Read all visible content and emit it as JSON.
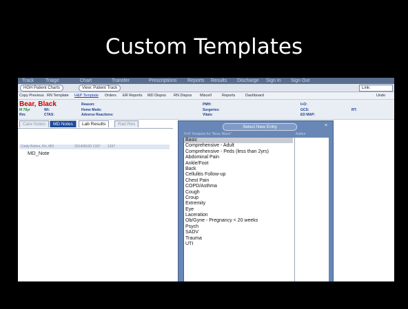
{
  "slide_title": "Custom Templates",
  "nav_tabs": [
    "Track",
    "Triage",
    "Chart",
    "Transfer",
    "Prescriptions",
    "Reports",
    "Results",
    "Discharge",
    "Sign In",
    "Sign Out"
  ],
  "patient_chart_button": "HGH Patient Charts",
  "view_track_button": "View: Patient Track",
  "link_label": "Link:",
  "toolbar": {
    "copy_previous": "Copy Previous",
    "rn_template": "RN Template",
    "hp_template": "H&P Template",
    "orders": "Orders",
    "er_reports": "ER Reports",
    "md_dispos": "MD Dispos",
    "rn_dispos": "RN Dispos",
    "miscell": "Miscell",
    "reports": "Reports",
    "dashboard": "Dashboard",
    "undo": "Undo"
  },
  "patient": {
    "name": "Bear, Black",
    "line2": "M 78yr",
    "wt_label": "Wt:",
    "rm_label": "Rm:",
    "ctas_label": "CTAS:",
    "reason_label": "Reason:",
    "home_meds_label": "Home Meds:",
    "adverse_label": "Adverse Reactions:",
    "pmh_label": "PMH:",
    "surgeries_label": "Surgeries:",
    "vitals_label": "Vitals:",
    "io_label": "I+O:",
    "gcs_label": "GCS:",
    "rt_label": "RT:",
    "edmap_label": "ED MAP:"
  },
  "tabs": {
    "care_notes": "Care Notes",
    "md_notes": "MD Notes",
    "lab_results": "Lab Results",
    "rad_results": "Rad Res"
  },
  "note_row": {
    "author": "Cindy Bolton, Rn, MD",
    "datetime": "2014/05/30 1337",
    "time": "1337"
  },
  "note_title": "MD_Note",
  "dialog": {
    "title": "Select New Entry",
    "close": "×",
    "col1": "H+P Template for \"Bear, Black\"",
    "col2": "Author",
    "items": [
      "Basic",
      "Comprehensive - Adult",
      "Comprehensive - Peds (less than 2yrs)",
      "Abdominal Pain",
      "Ankle/Foot",
      "Back",
      "Cellulitis Follow-up",
      "Chest Pain",
      "COPD/Asthma",
      "Cough",
      "Croup",
      "Extremity",
      "Eye",
      "Laceration",
      "Ob/Gyne - Pregnancy < 20 weeks",
      "Psych",
      "SADV",
      "Trauma",
      "UTI"
    ],
    "selected_item": "Basic"
  }
}
